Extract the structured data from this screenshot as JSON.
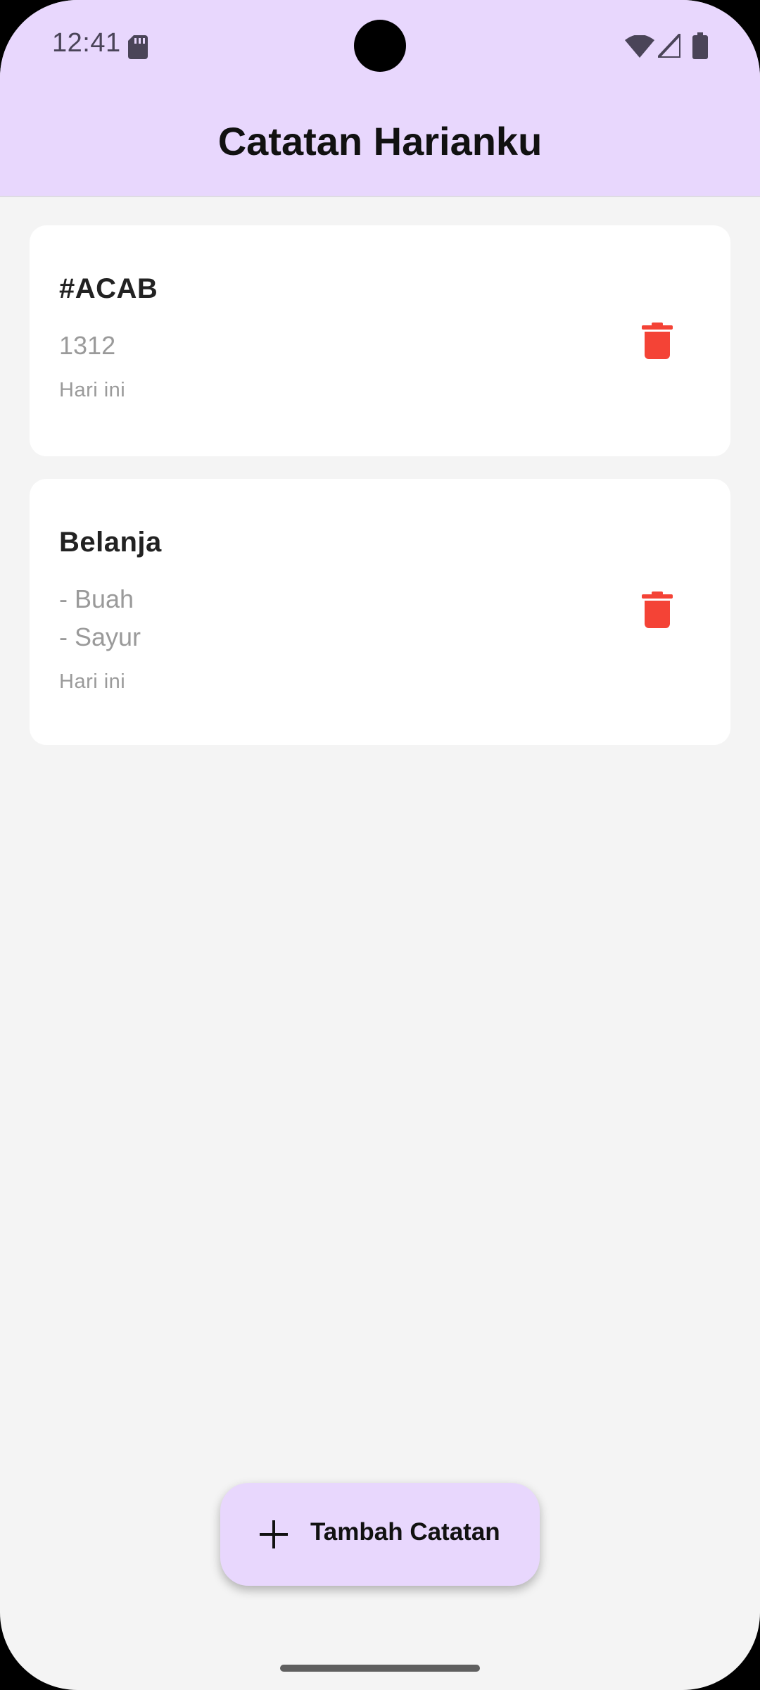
{
  "status_bar": {
    "time": "12:41",
    "icons": [
      "sd-card-icon",
      "wifi-icon",
      "cell-signal-icon",
      "battery-icon"
    ]
  },
  "app_bar": {
    "title": "Catatan Harianku",
    "background_color": "#e8d7fd"
  },
  "notes": [
    {
      "title": "#ACAB",
      "content": "1312",
      "date": "Hari ini",
      "delete_icon": "trash-icon"
    },
    {
      "title": "Belanja",
      "content": "- Buah\n- Sayur",
      "date": "Hari ini",
      "delete_icon": "trash-icon"
    }
  ],
  "fab": {
    "label": "Tambah Catatan",
    "icon": "plus-icon"
  },
  "colors": {
    "accent": "#e8d7fd",
    "delete": "#f44336",
    "background": "#f4f4f4"
  }
}
